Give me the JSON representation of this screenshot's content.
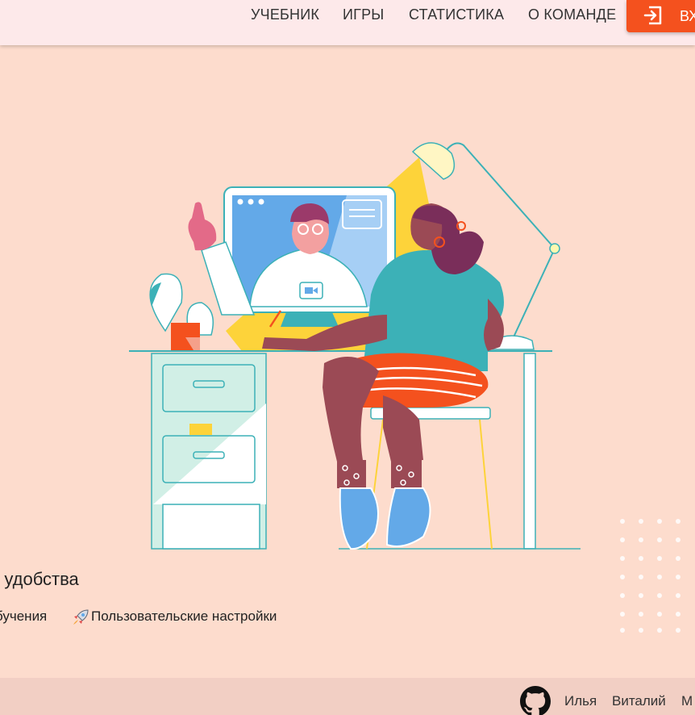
{
  "nav": {
    "items": [
      "УЧЕБНИК",
      "ИГРЫ",
      "СТАТИСТИКА",
      "О КОМАНДЕ"
    ],
    "login_label": "ВХ",
    "login_icon": "login-icon"
  },
  "hero": {
    "illustration": "person-at-desk-video-call-illustration",
    "headline": "о удобства",
    "features": [
      "бучения",
      "Пользовательские настройки"
    ],
    "feature_icon": "rocket-icon"
  },
  "footer": {
    "github_icon": "github-icon",
    "authors": [
      "Илья",
      "Виталий",
      "М"
    ]
  },
  "colors": {
    "background": "#fddccd",
    "header": "#fde9ea",
    "accent": "#f4511e",
    "footer": "#f2cfc4"
  }
}
